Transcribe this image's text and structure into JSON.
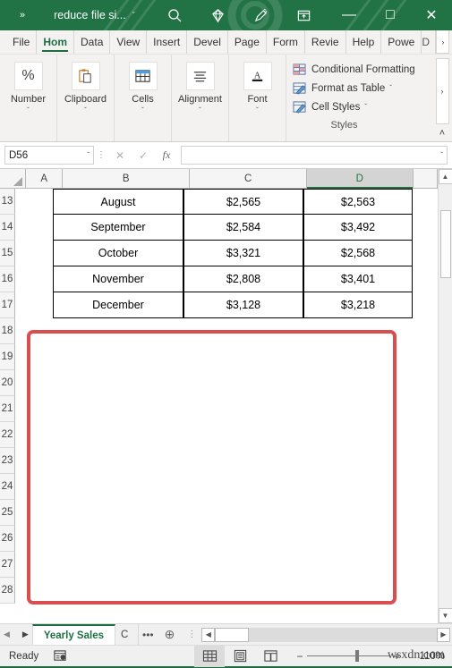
{
  "titlebar": {
    "qat_overflow": "»",
    "document_name": "reduce file si...",
    "chevron": "ˇ",
    "icons": [
      "search-icon",
      "diamond-icon",
      "pen-icon",
      "ribbon-display-options-icon"
    ],
    "minimize": "—",
    "maximize": "□",
    "close": "✕",
    "accent_color": "#217346"
  },
  "ribbon": {
    "tabs": [
      {
        "label": "File"
      },
      {
        "label": "Hom",
        "active": true
      },
      {
        "label": "Data"
      },
      {
        "label": "View"
      },
      {
        "label": "Insert"
      },
      {
        "label": "Devel"
      },
      {
        "label": "Page"
      },
      {
        "label": "Form"
      },
      {
        "label": "Revie"
      },
      {
        "label": "Help"
      },
      {
        "label": "Powe"
      },
      {
        "label": "D",
        "clipped": true
      }
    ],
    "tab_scroll_right": "›",
    "groups": [
      {
        "label": "Number",
        "icon": "percent-icon",
        "glyph": "%",
        "chevron": "ˇ"
      },
      {
        "label": "Clipboard",
        "icon": "clipboard-icon",
        "chevron": "ˇ"
      },
      {
        "label": "Cells",
        "icon": "cells-table-icon",
        "chevron": "ˇ"
      },
      {
        "label": "Alignment",
        "icon": "alignment-icon",
        "chevron": "ˇ"
      },
      {
        "label": "Font",
        "icon": "font-a-icon",
        "chevron": "ˇ"
      }
    ],
    "styles": {
      "group_label": "Styles",
      "items": [
        {
          "label": "Conditional Formatting",
          "icon": "conditional-formatting-icon",
          "chevron": ""
        },
        {
          "label": "Format as Table",
          "icon": "format-as-table-icon",
          "chevron": "ˇ"
        },
        {
          "label": "Cell Styles",
          "icon": "cell-styles-icon",
          "chevron": "ˇ"
        }
      ]
    },
    "expand_arrow": "›",
    "collapse_chevron": "˄"
  },
  "formula_bar": {
    "name_box_value": "D56",
    "name_box_chevron": "ˇ",
    "dots": "⋮",
    "cancel_icon": "✕",
    "enter_icon": "✓",
    "function_icon": "fx",
    "formula_value": "",
    "expand_chevron": "ˇ"
  },
  "grid": {
    "columns": [
      "A",
      "B",
      "C",
      "D"
    ],
    "selected_column": "D",
    "rows": [
      {
        "num": "13",
        "b": "August",
        "c": "$2,565",
        "d": "$2,563",
        "bordered": true
      },
      {
        "num": "14",
        "b": "September",
        "c": "$2,584",
        "d": "$3,492",
        "bordered": true
      },
      {
        "num": "15",
        "b": "October",
        "c": "$3,321",
        "d": "$2,568",
        "bordered": true
      },
      {
        "num": "16",
        "b": "November",
        "c": "$2,808",
        "d": "$3,401",
        "bordered": true
      },
      {
        "num": "17",
        "b": "December",
        "c": "$3,128",
        "d": "$3,218",
        "bordered": true
      },
      {
        "num": "18",
        "b": "",
        "c": "",
        "d": "",
        "bordered": false
      },
      {
        "num": "19",
        "b": "",
        "c": "",
        "d": "",
        "bordered": false
      },
      {
        "num": "20",
        "b": "",
        "c": "",
        "d": "",
        "bordered": false
      },
      {
        "num": "21",
        "b": "",
        "c": "",
        "d": "",
        "bordered": false
      },
      {
        "num": "22",
        "b": "",
        "c": "",
        "d": "",
        "bordered": false
      },
      {
        "num": "23",
        "b": "",
        "c": "",
        "d": "",
        "bordered": false
      },
      {
        "num": "24",
        "b": "",
        "c": "",
        "d": "",
        "bordered": false
      },
      {
        "num": "25",
        "b": "",
        "c": "",
        "d": "",
        "bordered": false
      },
      {
        "num": "26",
        "b": "",
        "c": "",
        "d": "",
        "bordered": false
      },
      {
        "num": "27",
        "b": "",
        "c": "",
        "d": "",
        "bordered": false
      },
      {
        "num": "28",
        "b": "",
        "c": "",
        "d": "",
        "bordered": false
      }
    ],
    "annotation": {
      "type": "red-rectangle-highlight",
      "color": "#d94f4f",
      "content": ""
    },
    "vscroll_up": "▲",
    "vscroll_down": "▼"
  },
  "sheetbar": {
    "nav_prev": "◀",
    "nav_next": "▶",
    "tabs": [
      {
        "label": "Yearly Sales",
        "active": true
      },
      {
        "label": "C",
        "active": false,
        "clipped": true
      }
    ],
    "overflow_dots": "•••",
    "add_sheet": "⊕",
    "vertical_dots": "⋮",
    "hscroll_left": "◀",
    "hscroll_right": "▶"
  },
  "statusbar": {
    "mode": "Ready",
    "macro_icon": "record-macro-icon",
    "views": [
      {
        "name": "normal-view",
        "glyph": "grid",
        "active": true
      },
      {
        "name": "page-layout-view",
        "glyph": "page",
        "active": false
      },
      {
        "name": "page-break-view",
        "glyph": "break",
        "active": false
      }
    ],
    "zoom_out": "−",
    "zoom_in": "+",
    "zoom_level": "110%",
    "watermark": "wsxdn.com"
  }
}
